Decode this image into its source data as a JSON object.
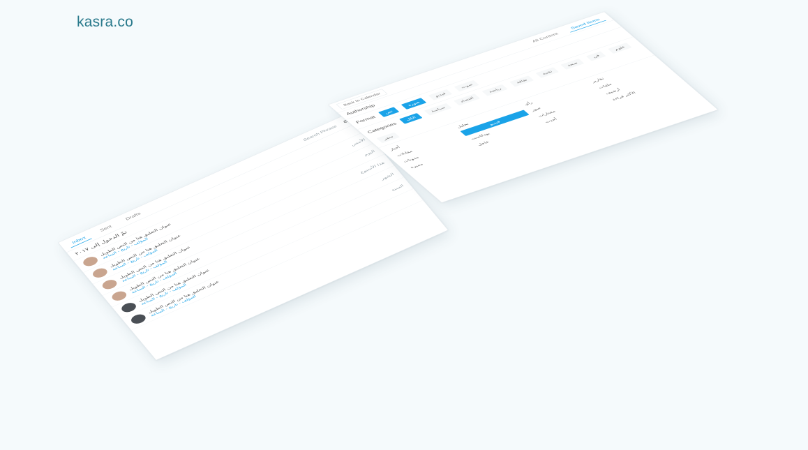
{
  "brand": "kasra.co",
  "left_panel": {
    "tabs": [
      "Inbox",
      "Sent",
      "Drafts"
    ],
    "search_placeholder": "Search Phrase",
    "title": "تمّ الدخول إلى ٢٠١٧",
    "items": [
      {
        "text": "عنوان التعليق هنا من النص الطويل",
        "tag": "المؤلف - تاريخ - الساعة"
      },
      {
        "text": "عنوان التعليق هنا من النص الطويل",
        "tag": "المؤلف - تاريخ - الساعة"
      },
      {
        "text": "عنوان التعليق هنا من النص الطويل",
        "tag": "المؤلف - تاريخ - الساعة"
      },
      {
        "text": "عنوان التعليق هنا من النص الطويل",
        "tag": "المؤلف - تاريخ - الساعة"
      },
      {
        "text": "عنوان التعليق هنا من النص الطويل",
        "tag": "المؤلف - تاريخ - الساعة"
      },
      {
        "text": "عنوان التعليق هنا من النص الطويل",
        "tag": "المؤلف - تاريخ - الساعة"
      }
    ],
    "side_labels": [
      "الأمس",
      "اليوم",
      "هذا الأسبوع",
      "الشهر",
      "السنة"
    ]
  },
  "right_panel": {
    "tabs": [
      "All Content",
      "Saved Items"
    ],
    "authorship_label": "Authorship",
    "format_label": "Format",
    "format_chips": [
      "نص",
      "صورة",
      "فيديو",
      "صوت"
    ],
    "categories_label": "Categories",
    "category_chips": [
      "الكل",
      "سياسة",
      "اقتصاد",
      "رياضة",
      "ثقافة",
      "تقنية",
      "صحة",
      "فن",
      "علوم",
      "سفر"
    ],
    "back_button": "Back to Calendar",
    "grid_items": [
      "أخبار",
      "تحليل",
      "رأي",
      "تقارير",
      "مقابلات",
      "فيديو",
      "صور",
      "ملفات",
      "مدونات",
      "بودكاست",
      "مختارات",
      "أرشيف",
      "مميزة",
      "عاجل",
      "أحدث",
      "الأكثر قراءة"
    ]
  }
}
